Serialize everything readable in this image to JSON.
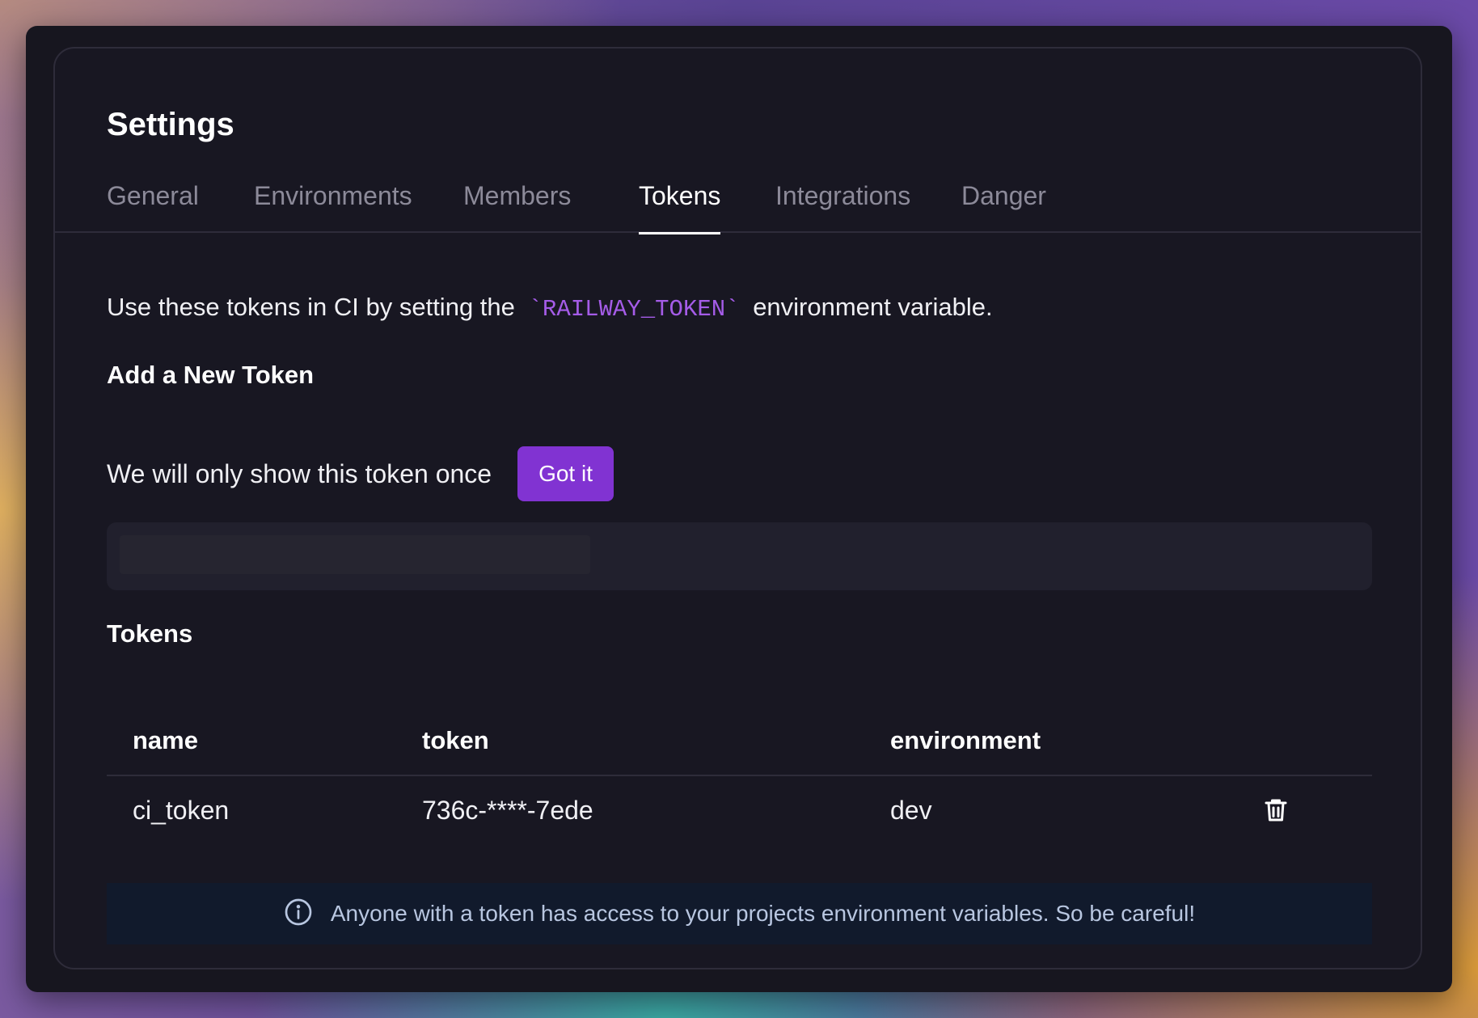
{
  "page": {
    "title": "Settings"
  },
  "tabs": [
    {
      "label": "General",
      "active": false
    },
    {
      "label": "Environments",
      "active": false
    },
    {
      "label": "Members",
      "active": false
    },
    {
      "label": "Tokens",
      "active": true
    },
    {
      "label": "Integrations",
      "active": false
    },
    {
      "label": "Danger",
      "active": false
    }
  ],
  "description": {
    "prefix": "Use these tokens in CI by setting the",
    "code": "`RAILWAY_TOKEN`",
    "suffix": "environment variable."
  },
  "add_token": {
    "title": "Add a New Token",
    "notice": "We will only show this token once",
    "got_it_label": "Got it"
  },
  "tokens": {
    "title": "Tokens",
    "columns": [
      "name",
      "token",
      "environment"
    ],
    "rows": [
      {
        "name": "ci_token",
        "token": "736c-****-7ede",
        "environment": "dev"
      }
    ]
  },
  "alert": {
    "text": "Anyone with a token has access to your projects environment variables. So be careful!"
  },
  "colors": {
    "accent": "#8133d2",
    "code": "#a55ce8",
    "background": "#181722",
    "alert_bg": "#111a2c"
  },
  "icons": {
    "delete": "trash-icon",
    "info": "info-icon"
  }
}
